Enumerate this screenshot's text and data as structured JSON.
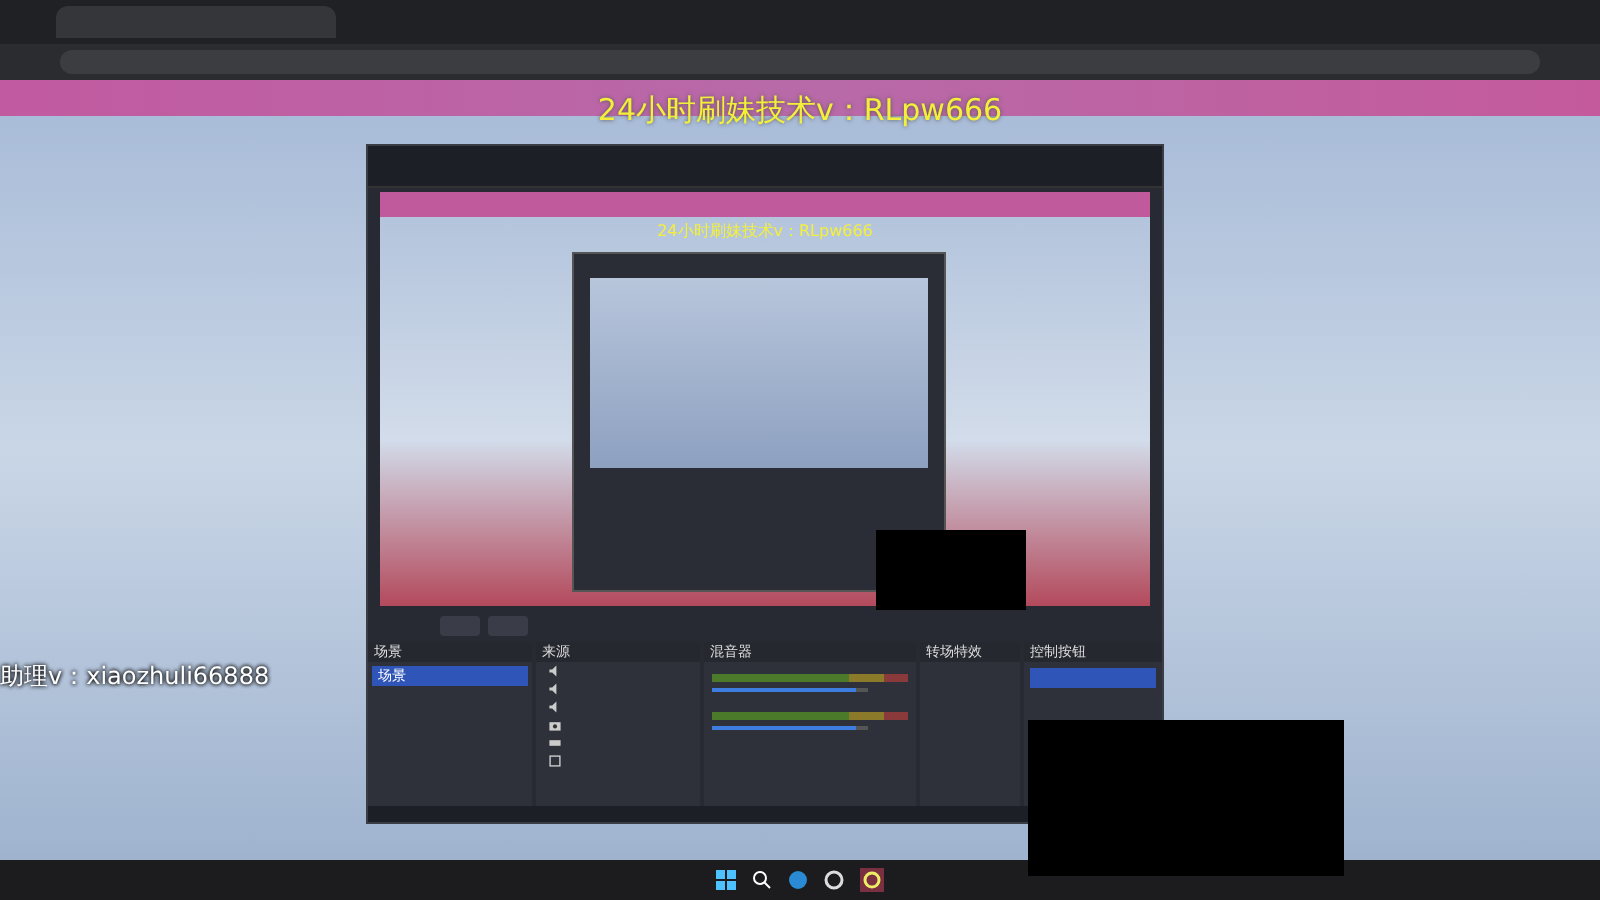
{
  "overlay_texts": [
    {
      "kind": "banner",
      "text": "24小时刷妹技术v：RLpw666"
    },
    {
      "kind": "side",
      "text": "助理v：xiaozhuli66888"
    }
  ],
  "obs": {
    "preview_overlay_text": "24小时刷妹技术v：RLpw666",
    "docks": [
      {
        "title": "场景"
      },
      {
        "title": "来源"
      },
      {
        "title": "混音器"
      },
      {
        "title": "转场特效"
      },
      {
        "title": "控制按钮"
      }
    ],
    "scenes": [
      {
        "name": "场景",
        "selected": true
      }
    ],
    "sources": [
      {
        "kind": "audio"
      },
      {
        "kind": "audio"
      },
      {
        "kind": "audio"
      },
      {
        "kind": "camera"
      },
      {
        "kind": "display"
      },
      {
        "kind": "window"
      }
    ],
    "mixer": [
      {
        "level": 0.92
      },
      {
        "level": 0.92
      }
    ]
  }
}
